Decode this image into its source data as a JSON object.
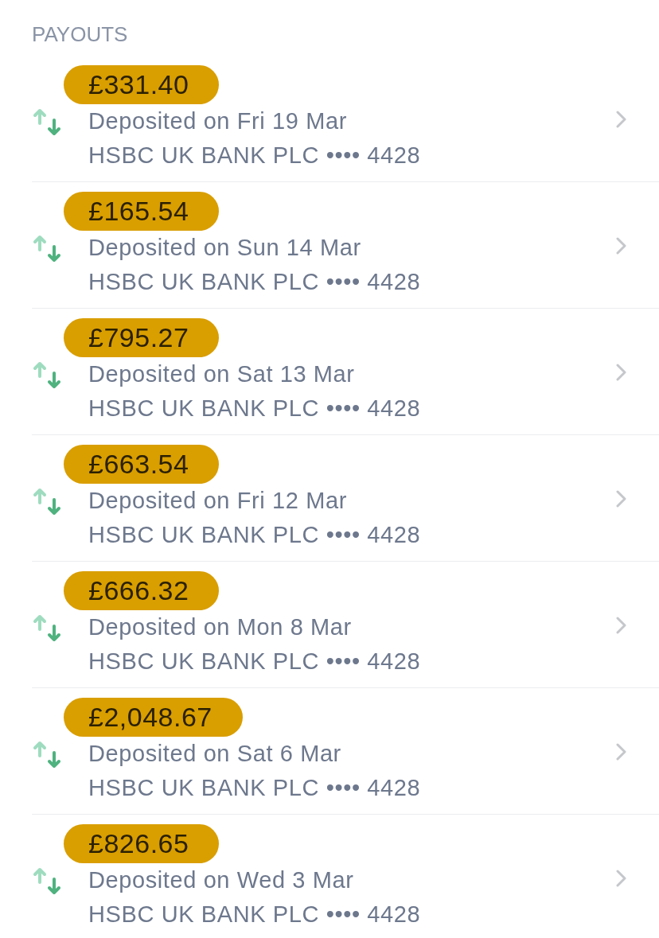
{
  "section_title": "PAYOUTS",
  "payouts": [
    {
      "amount": "£331.40",
      "description": "Deposited on Fri 19 Mar",
      "account": "HSBC UK BANK PLC •••• 4428"
    },
    {
      "amount": "£165.54",
      "description": "Deposited on Sun 14 Mar",
      "account": "HSBC UK BANK PLC •••• 4428"
    },
    {
      "amount": "£795.27",
      "description": "Deposited on Sat 13 Mar",
      "account": "HSBC UK BANK PLC •••• 4428"
    },
    {
      "amount": "£663.54",
      "description": "Deposited on Fri 12 Mar",
      "account": "HSBC UK BANK PLC •••• 4428"
    },
    {
      "amount": "£666.32",
      "description": "Deposited on Mon 8 Mar",
      "account": "HSBC UK BANK PLC •••• 4428"
    },
    {
      "amount": "£2,048.67",
      "description": "Deposited on Sat 6 Mar",
      "account": "HSBC UK BANK PLC •••• 4428"
    },
    {
      "amount": "£826.65",
      "description": "Deposited on Wed 3 Mar",
      "account": "HSBC UK BANK PLC •••• 4428"
    }
  ]
}
